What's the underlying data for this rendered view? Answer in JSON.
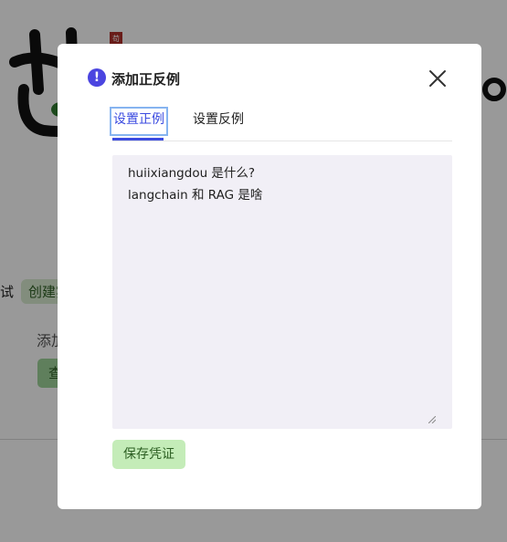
{
  "background": {
    "seal_text": "苟",
    "row_left_text": "试",
    "row_chip_text": "创建实",
    "add_text": "添加",
    "button_text": "查"
  },
  "modal": {
    "title": "添加正反例",
    "tabs": [
      {
        "label": "设置正例",
        "active": true
      },
      {
        "label": "设置反例",
        "active": false
      }
    ],
    "textarea": {
      "lines": [
        "huiixiangdou 是什么?",
        "langchain 和 RAG 是啥"
      ]
    },
    "save_label": "保存凭证"
  },
  "colors": {
    "accent": "#3b4be0",
    "info_icon": "#4b45e0",
    "save_button": "#c4ecb8",
    "textarea_bg": "#f1eff6"
  }
}
